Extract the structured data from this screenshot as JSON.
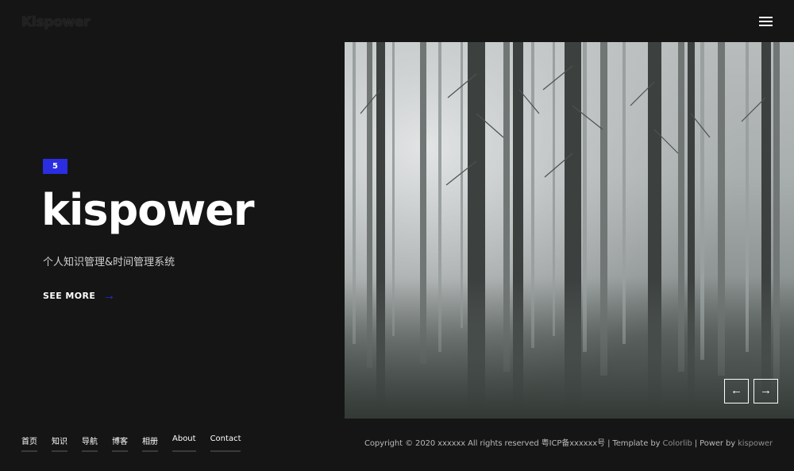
{
  "header": {
    "logo_text": "Kispower",
    "menu_icon": "hamburger-menu-icon"
  },
  "hero": {
    "slide_number": "5",
    "title": "kispower",
    "subtitle": "个人知识管理&时间管理系统",
    "see_more_label": "SEE MORE",
    "see_more_arrow": "→",
    "image_description_icon": "forest-image",
    "accent_color": "#2a2ee0"
  },
  "slider": {
    "prev_label": "←",
    "next_label": "→"
  },
  "footer": {
    "nav": [
      {
        "label": "首页"
      },
      {
        "label": "知识"
      },
      {
        "label": "导航"
      },
      {
        "label": "博客"
      },
      {
        "label": "相册"
      },
      {
        "label": "About"
      },
      {
        "label": "Contact"
      }
    ],
    "copyright_text": "Copyright © 2020 xxxxxx All rights reserved 粤ICP备xxxxxx号 | Template by ",
    "template_link": "Colorlib",
    "separator": " | Power by ",
    "power_link": "kispower"
  }
}
